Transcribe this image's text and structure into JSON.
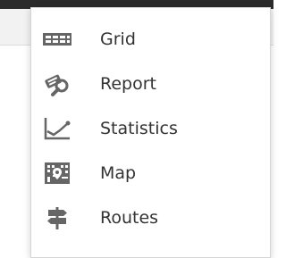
{
  "menu": {
    "items": [
      {
        "id": "grid",
        "label": "Grid",
        "icon": "grid-icon"
      },
      {
        "id": "report",
        "label": "Report",
        "icon": "report-icon"
      },
      {
        "id": "statistics",
        "label": "Statistics",
        "icon": "statistics-icon"
      },
      {
        "id": "map",
        "label": "Map",
        "icon": "map-icon"
      },
      {
        "id": "routes",
        "label": "Routes",
        "icon": "routes-icon"
      }
    ]
  },
  "colors": {
    "text": "#333333",
    "icon": "#666666",
    "menu_border": "#d6d6d6",
    "top_bar": "#2b2b2b",
    "background_panel": "#f2f2f2"
  }
}
